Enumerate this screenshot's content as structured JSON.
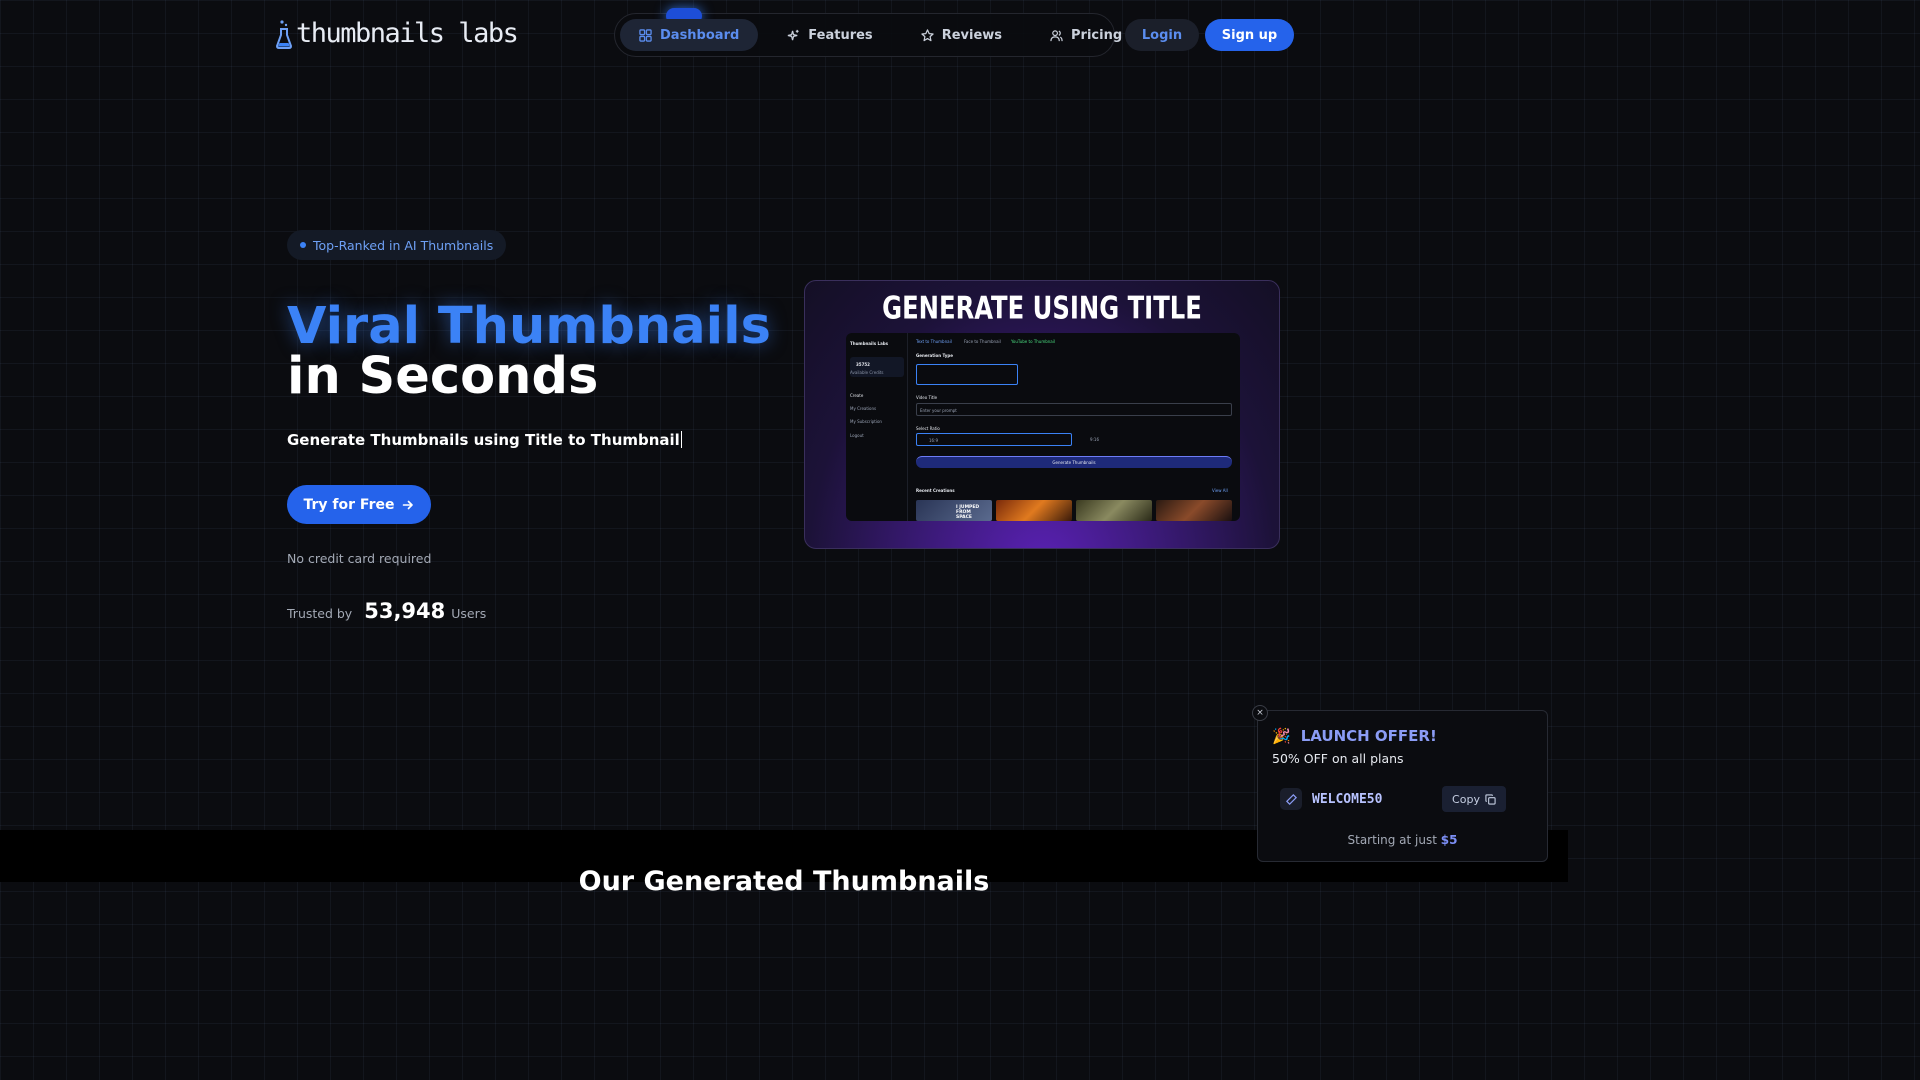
{
  "brand": {
    "name": "thumbnails labs",
    "icon": "flask-icon"
  },
  "nav": {
    "items": [
      {
        "label": "Dashboard",
        "icon": "grid-icon",
        "active": true
      },
      {
        "label": "Features",
        "icon": "sparkle-icon"
      },
      {
        "label": "Reviews",
        "icon": "star-icon"
      },
      {
        "label": "Pricing",
        "icon": "users-icon"
      }
    ],
    "login": "Login",
    "signup": "Sign up"
  },
  "hero": {
    "badge": "Top-Ranked in AI Thumbnails",
    "title_line1": "Viral Thumbnails",
    "title_line2": "in Seconds",
    "subtitle": "Generate Thumbnails using Title to Thumbnail",
    "cta": "Try for Free",
    "cta_icon": "arrow-right-icon",
    "note": "No credit card required",
    "trusted_label": "Trusted by",
    "trusted_count": "53,948",
    "trusted_unit": "Users"
  },
  "preview": {
    "title": "GENERATE USING TITLE",
    "app_name": "Thumbnails Labs",
    "credits": "35752",
    "credits_label": "Available Credits",
    "menu": [
      "Create",
      "My Creations",
      "My Subscription",
      "Logout"
    ],
    "tabs": [
      "Text to Thumbnail",
      "Face to Thumbnail",
      "YouTube to Thumbnail"
    ],
    "generation_type": "Generation Type",
    "video_title_label": "Video Title",
    "prompt_placeholder": "Enter your prompt",
    "ratio_label": "Select Ratio",
    "ratio_a": "16:9",
    "ratio_b": "9:16",
    "generate_btn": "Generate Thumbnails",
    "recent": "Recent Creations",
    "view_all": "View All",
    "thumb1_text": "I JUMPED FROM SPACE"
  },
  "offer": {
    "emoji": "🎉",
    "title": "LAUNCH OFFER!",
    "subtitle": "50% OFF on all plans",
    "code": "WELCOME50",
    "copy": "Copy",
    "start_text": "Starting at just",
    "price": "$5",
    "close": "×"
  },
  "section": {
    "title": "Our Generated Thumbnails"
  },
  "colors": {
    "accent": "#2563eb",
    "accent_light": "#3b82f6",
    "offer_accent": "#8b9cf5",
    "background": "#0b0c10"
  }
}
